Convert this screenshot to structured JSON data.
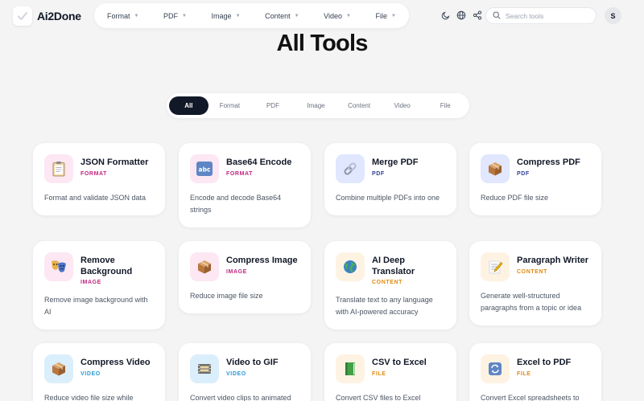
{
  "header": {
    "logo_text": "Ai2Done",
    "nav": [
      {
        "label": "Format"
      },
      {
        "label": "PDF"
      },
      {
        "label": "Image"
      },
      {
        "label": "Content"
      },
      {
        "label": "Video"
      },
      {
        "label": "File"
      }
    ],
    "search_placeholder": "Search tools",
    "avatar_letter": "S"
  },
  "page_title": "All Tools",
  "filters": [
    {
      "label": "All",
      "active": true
    },
    {
      "label": "Format"
    },
    {
      "label": "PDF"
    },
    {
      "label": "Image"
    },
    {
      "label": "Content"
    },
    {
      "label": "Video"
    },
    {
      "label": "File"
    }
  ],
  "category_colors": {
    "FORMAT": "#c0267f",
    "PDF": "#2d3f8f",
    "IMAGE": "#c0267f",
    "CONTENT": "#e08a12",
    "VIDEO": "#2a9bd4",
    "FILE": "#e08a12"
  },
  "cards": [
    {
      "title": "JSON Formatter",
      "category": "FORMAT",
      "description": "Format and validate JSON data",
      "icon": "clipboard-icon"
    },
    {
      "title": "Base64 Encode",
      "category": "FORMAT",
      "description": "Encode and decode Base64 strings",
      "icon": "abc-icon"
    },
    {
      "title": "Merge PDF",
      "category": "PDF",
      "description": "Combine multiple PDFs into one",
      "icon": "link-icon"
    },
    {
      "title": "Compress PDF",
      "category": "PDF",
      "description": "Reduce PDF file size",
      "icon": "package-icon"
    },
    {
      "title": "Remove Background",
      "category": "IMAGE",
      "description": "Remove image background with AI",
      "icon": "masks-icon"
    },
    {
      "title": "Compress Image",
      "category": "IMAGE",
      "description": "Reduce image file size",
      "icon": "package-icon"
    },
    {
      "title": "AI Deep Translator",
      "category": "CONTENT",
      "description": "Translate text to any language with AI-powered accuracy",
      "icon": "globe-icon"
    },
    {
      "title": "Paragraph Writer",
      "category": "CONTENT",
      "description": "Generate well-structured paragraphs from a topic or idea",
      "icon": "memo-icon"
    },
    {
      "title": "Compress Video",
      "category": "VIDEO",
      "description": "Reduce video file size while",
      "icon": "package-icon"
    },
    {
      "title": "Video to GIF",
      "category": "VIDEO",
      "description": "Convert video clips to animated",
      "icon": "film-icon"
    },
    {
      "title": "CSV to Excel",
      "category": "FILE",
      "description": "Convert CSV files to Excel",
      "icon": "green-book-icon"
    },
    {
      "title": "Excel to PDF",
      "category": "FILE",
      "description": "Convert Excel spreadsheets to",
      "icon": "refresh-icon"
    }
  ]
}
